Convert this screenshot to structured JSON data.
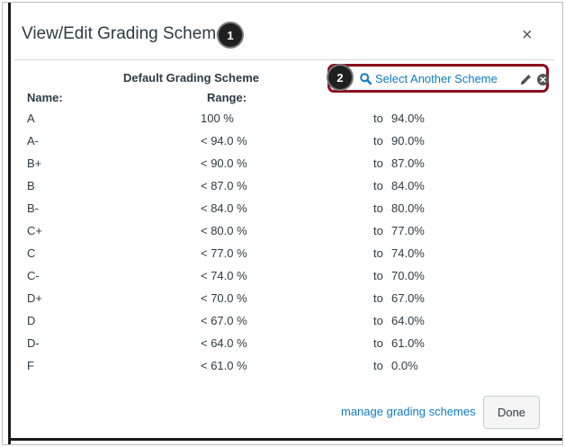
{
  "dialog": {
    "title": "View/Edit Grading Scheme",
    "close_glyph": "×"
  },
  "callouts": [
    "1",
    "2"
  ],
  "scheme": {
    "name": "Default Grading Scheme",
    "name_header": "Name:",
    "range_header": "Range:",
    "select_label": "Select Another Scheme",
    "select_icon": "search-icon",
    "edit_icon": "pencil-icon",
    "remove_icon": "x-circle-icon"
  },
  "grades": [
    {
      "name": "A",
      "range": "100 %",
      "to": "to",
      "min": "94.0%"
    },
    {
      "name": "A-",
      "range": "< 94.0 %",
      "to": "to",
      "min": "90.0%"
    },
    {
      "name": "B+",
      "range": "< 90.0 %",
      "to": "to",
      "min": "87.0%"
    },
    {
      "name": "B",
      "range": "< 87.0 %",
      "to": "to",
      "min": "84.0%"
    },
    {
      "name": "B-",
      "range": "< 84.0 %",
      "to": "to",
      "min": "80.0%"
    },
    {
      "name": "C+",
      "range": "< 80.0 %",
      "to": "to",
      "min": "77.0%"
    },
    {
      "name": "C",
      "range": "< 77.0 %",
      "to": "to",
      "min": "74.0%"
    },
    {
      "name": "C-",
      "range": "< 74.0 %",
      "to": "to",
      "min": "70.0%"
    },
    {
      "name": "D+",
      "range": "< 70.0 %",
      "to": "to",
      "min": "67.0%"
    },
    {
      "name": "D",
      "range": "< 67.0 %",
      "to": "to",
      "min": "64.0%"
    },
    {
      "name": "D-",
      "range": "< 64.0 %",
      "to": "to",
      "min": "61.0%"
    },
    {
      "name": "F",
      "range": "< 61.0 %",
      "to": "to",
      "min": "0.0%"
    }
  ],
  "footer": {
    "manage_label": "manage grading schemes",
    "done_label": "Done"
  },
  "colors": {
    "link": "#0e7bc3",
    "highlight_border": "#8b0e1e",
    "text": "#2d3b45"
  }
}
